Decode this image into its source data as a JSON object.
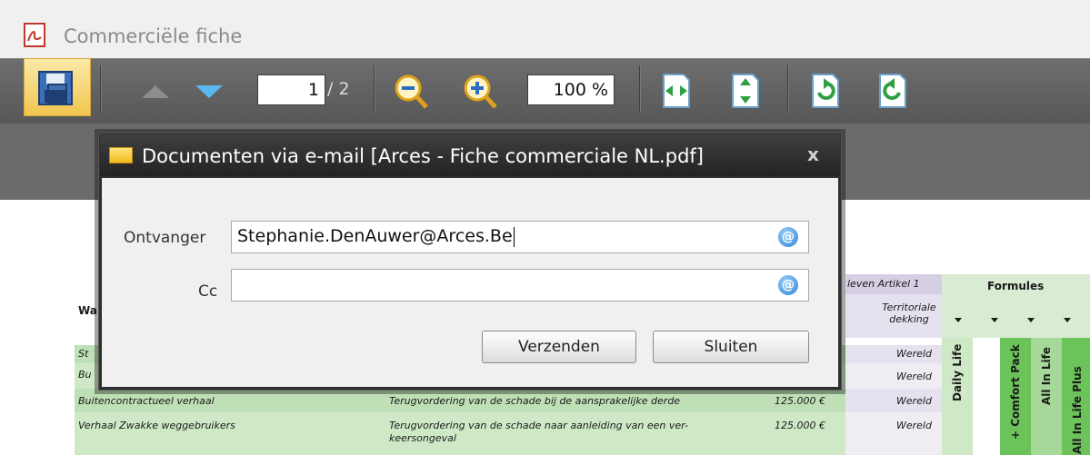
{
  "window": {
    "title": "Commerciële fiche"
  },
  "toolbar": {
    "page_current": "1",
    "page_total": "/ 2",
    "zoom": "100 %"
  },
  "dialog": {
    "title": "Documenten via e-mail [Arces - Fiche commerciale NL.pdf]",
    "close": "x",
    "recipient_label": "Ontvanger",
    "recipient_value": "Stephanie.DenAuwer@Arces.Be",
    "cc_label": "Cc",
    "cc_value": "",
    "send_label": "Verzenden",
    "close_label": "Sluiten"
  },
  "document": {
    "col_header_partial": "leven Artikel 1",
    "territorial_header": "Territoriale dekking",
    "formules_header": "Formules",
    "left_header_partial": "Wa",
    "rows": [
      {
        "name": "St",
        "territory": "Wereld"
      },
      {
        "name": "Bu",
        "territory": "Wereld"
      },
      {
        "name": "Buitencontractueel verhaal",
        "desc": "Terugvordering van de schade bij de aansprakelijke derde",
        "amount": "125.000 €",
        "territory": "Wereld"
      },
      {
        "name": "Verhaal Zwakke weggebruikers",
        "desc": "Terugvordering van de schade naar aanleiding van een verkeersongeval",
        "desc_line1": "Terugvordering van de schade naar aanleiding van een ver-",
        "desc_line2": "keersongeval",
        "amount": "125.000 €",
        "territory": "Wereld"
      }
    ],
    "vertical_cols": [
      "Daily Life",
      "+ Comfort Pack",
      "All In Life",
      "All In Life Plus"
    ]
  }
}
